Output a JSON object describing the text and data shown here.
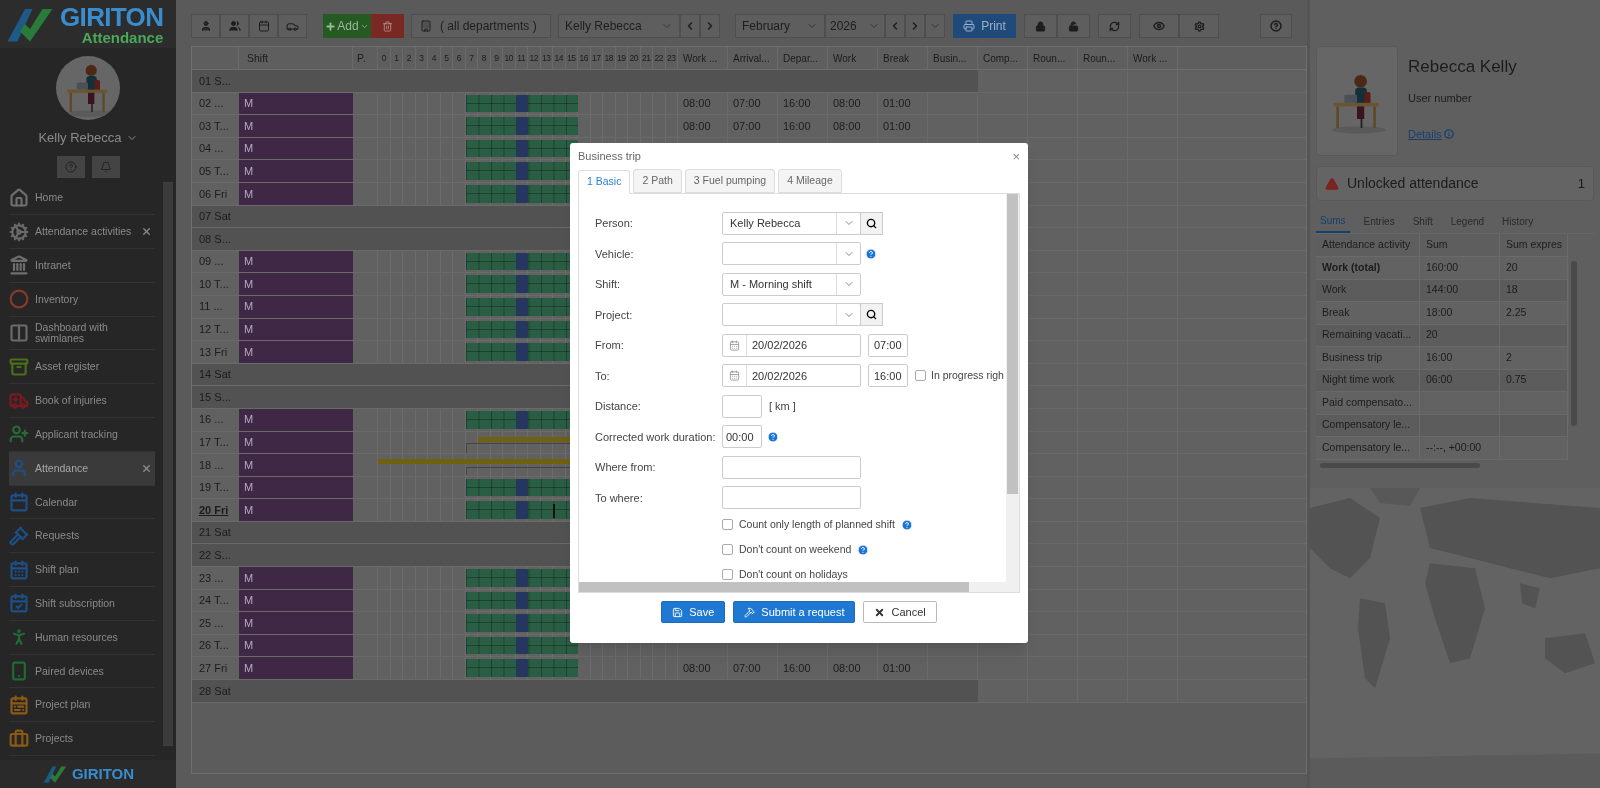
{
  "sidebar": {
    "brand": "GIRITON",
    "product": "Attendance",
    "user_name": "Kelly Rebecca",
    "items": [
      {
        "label": "Home",
        "color": "#6e6e6e",
        "selected": false,
        "closable": false
      },
      {
        "label": "Attendance activities",
        "color": "#696969",
        "selected": false,
        "closable": true
      },
      {
        "label": "Intranet",
        "color": "#6e6e6e",
        "selected": false,
        "closable": false
      },
      {
        "label": "Inventory",
        "color": "#8a3a2a",
        "selected": false,
        "closable": false
      },
      {
        "label": "Dashboard with swimlanes",
        "color": "#6a6a6a",
        "selected": false,
        "closable": false
      },
      {
        "label": "Asset register",
        "color": "#4a6e1a",
        "selected": false,
        "closable": false
      },
      {
        "label": "Book of injuries",
        "color": "#7a1a20",
        "selected": false,
        "closable": false
      },
      {
        "label": "Applicant tracking",
        "color": "#2a6a38",
        "selected": false,
        "closable": false
      },
      {
        "label": "Attendance",
        "color": "#1e4f86",
        "selected": true,
        "closable": true
      },
      {
        "label": "Calendar",
        "color": "#1e4f86",
        "selected": false,
        "closable": false
      },
      {
        "label": "Requests",
        "color": "#1e4f86",
        "selected": false,
        "closable": false
      },
      {
        "label": "Shift plan",
        "color": "#1e4f86",
        "selected": false,
        "closable": false
      },
      {
        "label": "Shift subscription",
        "color": "#1e4f86",
        "selected": false,
        "closable": false
      },
      {
        "label": "Human resources",
        "color": "#1f6a35",
        "selected": false,
        "closable": false
      },
      {
        "label": "Paired devices",
        "color": "#1f6a35",
        "selected": false,
        "closable": false
      },
      {
        "label": "Project plan",
        "color": "#8a5a14",
        "selected": false,
        "closable": false
      },
      {
        "label": "Projects",
        "color": "#8a5a14",
        "selected": false,
        "closable": false
      }
    ],
    "footer_brand": "GIRITON"
  },
  "toolbar": {
    "add": "Add",
    "departments": "( all departments )",
    "person": "Kelly Rebecca",
    "month": "February",
    "year": "2026",
    "print": "Print"
  },
  "grid": {
    "columns": [
      "Shift",
      "P.",
      "Work ...",
      "Arrival...",
      "Depar...",
      "Work",
      "Break",
      "Busin...",
      "Comp...",
      "Roun...",
      "Roun...",
      "Work ..."
    ],
    "hours": [
      "0",
      "1",
      "2",
      "3",
      "4",
      "5",
      "6",
      "7",
      "8",
      "9",
      "10",
      "11",
      "12",
      "13",
      "14",
      "15",
      "16",
      "17",
      "18",
      "19",
      "20",
      "21",
      "22",
      "23"
    ],
    "rows": [
      {
        "day": "01 S...",
        "kind": "weekend",
        "today": false
      },
      {
        "day": "02 ...",
        "kind": "workday",
        "today": false,
        "shift": "M",
        "values": [
          "08:00",
          "07:00",
          "16:00",
          "08:00",
          "01:00"
        ]
      },
      {
        "day": "03 T...",
        "kind": "workday",
        "today": false,
        "shift": "M",
        "values": [
          "08:00",
          "07:00",
          "16:00",
          "08:00",
          "01:00"
        ]
      },
      {
        "day": "04 ...",
        "kind": "workday",
        "today": false,
        "shift": "M"
      },
      {
        "day": "05 T...",
        "kind": "workday",
        "today": false,
        "shift": "M"
      },
      {
        "day": "06 Fri",
        "kind": "workday",
        "today": false,
        "shift": "M"
      },
      {
        "day": "07 Sat",
        "kind": "weekend",
        "today": false
      },
      {
        "day": "08 S...",
        "kind": "weekend",
        "today": false
      },
      {
        "day": "09 ...",
        "kind": "workday",
        "today": false,
        "shift": "M"
      },
      {
        "day": "10 T...",
        "kind": "workday",
        "today": false,
        "shift": "M"
      },
      {
        "day": "11 ...",
        "kind": "workday",
        "today": false,
        "shift": "M"
      },
      {
        "day": "12 T...",
        "kind": "workday",
        "today": false,
        "shift": "M"
      },
      {
        "day": "13 Fri",
        "kind": "workday",
        "today": false,
        "shift": "M"
      },
      {
        "day": "14 Sat",
        "kind": "weekend",
        "today": false
      },
      {
        "day": "15 S...",
        "kind": "weekend",
        "today": false
      },
      {
        "day": "16 ...",
        "kind": "workday",
        "today": false,
        "shift": "M"
      },
      {
        "day": "17 T...",
        "kind": "trip",
        "today": false,
        "shift": "M"
      },
      {
        "day": "18 ...",
        "kind": "trip_overnight",
        "today": false,
        "shift": "M"
      },
      {
        "day": "19 T...",
        "kind": "workday",
        "today": false,
        "shift": "M"
      },
      {
        "day": "20 Fri",
        "kind": "workday",
        "today": true,
        "shift": "M"
      },
      {
        "day": "21 Sat",
        "kind": "weekend",
        "today": false
      },
      {
        "day": "22 S...",
        "kind": "weekend",
        "today": false
      },
      {
        "day": "23 ...",
        "kind": "workday",
        "today": false,
        "shift": "M"
      },
      {
        "day": "24 T...",
        "kind": "workday",
        "today": false,
        "shift": "M"
      },
      {
        "day": "25 ...",
        "kind": "workday",
        "today": false,
        "shift": "M"
      },
      {
        "day": "26 T...",
        "kind": "workday",
        "today": false,
        "shift": "M"
      },
      {
        "day": "27 Fri",
        "kind": "workday",
        "today": false,
        "shift": "M",
        "values": [
          "08:00",
          "07:00",
          "16:00",
          "08:00",
          "01:00"
        ]
      },
      {
        "day": "28 Sat",
        "kind": "weekend",
        "today": false
      }
    ]
  },
  "profile": {
    "name": "Rebecca Kelly",
    "user_number_label": "User number",
    "details": "Details"
  },
  "alert": {
    "text": "Unlocked attendance",
    "count": "1"
  },
  "summary": {
    "tabs": [
      {
        "label": "Sums",
        "selected": true
      },
      {
        "label": "Entries",
        "selected": false
      },
      {
        "label": "Shift",
        "selected": false
      },
      {
        "label": "Legend",
        "selected": false
      },
      {
        "label": "History",
        "selected": false
      }
    ],
    "columns": [
      "Attendance activity",
      "Sum",
      "Sum expres"
    ],
    "rows": [
      {
        "cells": [
          "Work (total)",
          "160:00",
          "20"
        ],
        "total": true
      },
      {
        "cells": [
          "Work",
          "144:00",
          "18"
        ],
        "total": false
      },
      {
        "cells": [
          "Break",
          "18:00",
          "2.25"
        ],
        "total": false
      },
      {
        "cells": [
          "Remaining vacati...",
          "20",
          ""
        ],
        "total": false
      },
      {
        "cells": [
          "Business trip",
          "16:00",
          "2"
        ],
        "total": false
      },
      {
        "cells": [
          "Night time work",
          "06:00",
          "0.75"
        ],
        "total": false
      },
      {
        "cells": [
          "Paid compensato...",
          "",
          ""
        ],
        "total": false
      },
      {
        "cells": [
          "Compensatory le...",
          "",
          ""
        ],
        "total": false
      },
      {
        "cells": [
          "Compensatory le...",
          "--:--, +00:00",
          ""
        ],
        "total": false
      }
    ]
  },
  "dialog": {
    "title": "Business trip",
    "close": "×",
    "tabs": [
      {
        "label": "1 Basic",
        "selected": true
      },
      {
        "label": "2 Path",
        "selected": false
      },
      {
        "label": "3 Fuel pumping",
        "selected": false
      },
      {
        "label": "4 Mileage",
        "selected": false
      }
    ],
    "fields": [
      {
        "kind": "select",
        "label": "Person:",
        "value": "Kelly Rebecca",
        "search": true,
        "help": false
      },
      {
        "kind": "select",
        "label": "Vehicle:",
        "search": false,
        "help": true
      },
      {
        "kind": "select",
        "label": "Shift:",
        "value": "M - Morning shift",
        "search": false,
        "help": false
      },
      {
        "kind": "select",
        "label": "Project:",
        "search": true,
        "help": false
      },
      {
        "kind": "datetime",
        "label": "From:",
        "date": "20/02/2026",
        "time": "07:00"
      },
      {
        "kind": "datetime",
        "label": "To:",
        "date": "20/02/2026",
        "time": "16:00",
        "option": {
          "label": "In progress righ",
          "checked": false
        }
      },
      {
        "kind": "number",
        "label": "Distance:",
        "unit": "[ km ]"
      },
      {
        "kind": "time",
        "label": "Corrected work duration:",
        "value": "00:00",
        "help": true
      },
      {
        "kind": "text",
        "label": "Where from:"
      },
      {
        "kind": "text",
        "label": "To where:"
      }
    ],
    "checkboxes": [
      {
        "label": "Count only length of planned shift",
        "checked": false,
        "help": true
      },
      {
        "label": "Don't count on weekend",
        "checked": false,
        "help": true
      },
      {
        "label": "Don't count on holidays",
        "checked": false,
        "help": false
      }
    ],
    "buttons": [
      {
        "label": "Save",
        "kind": "primary"
      },
      {
        "label": "Submit a request",
        "kind": "primary"
      },
      {
        "label": "Cancel",
        "kind": "default"
      }
    ]
  }
}
